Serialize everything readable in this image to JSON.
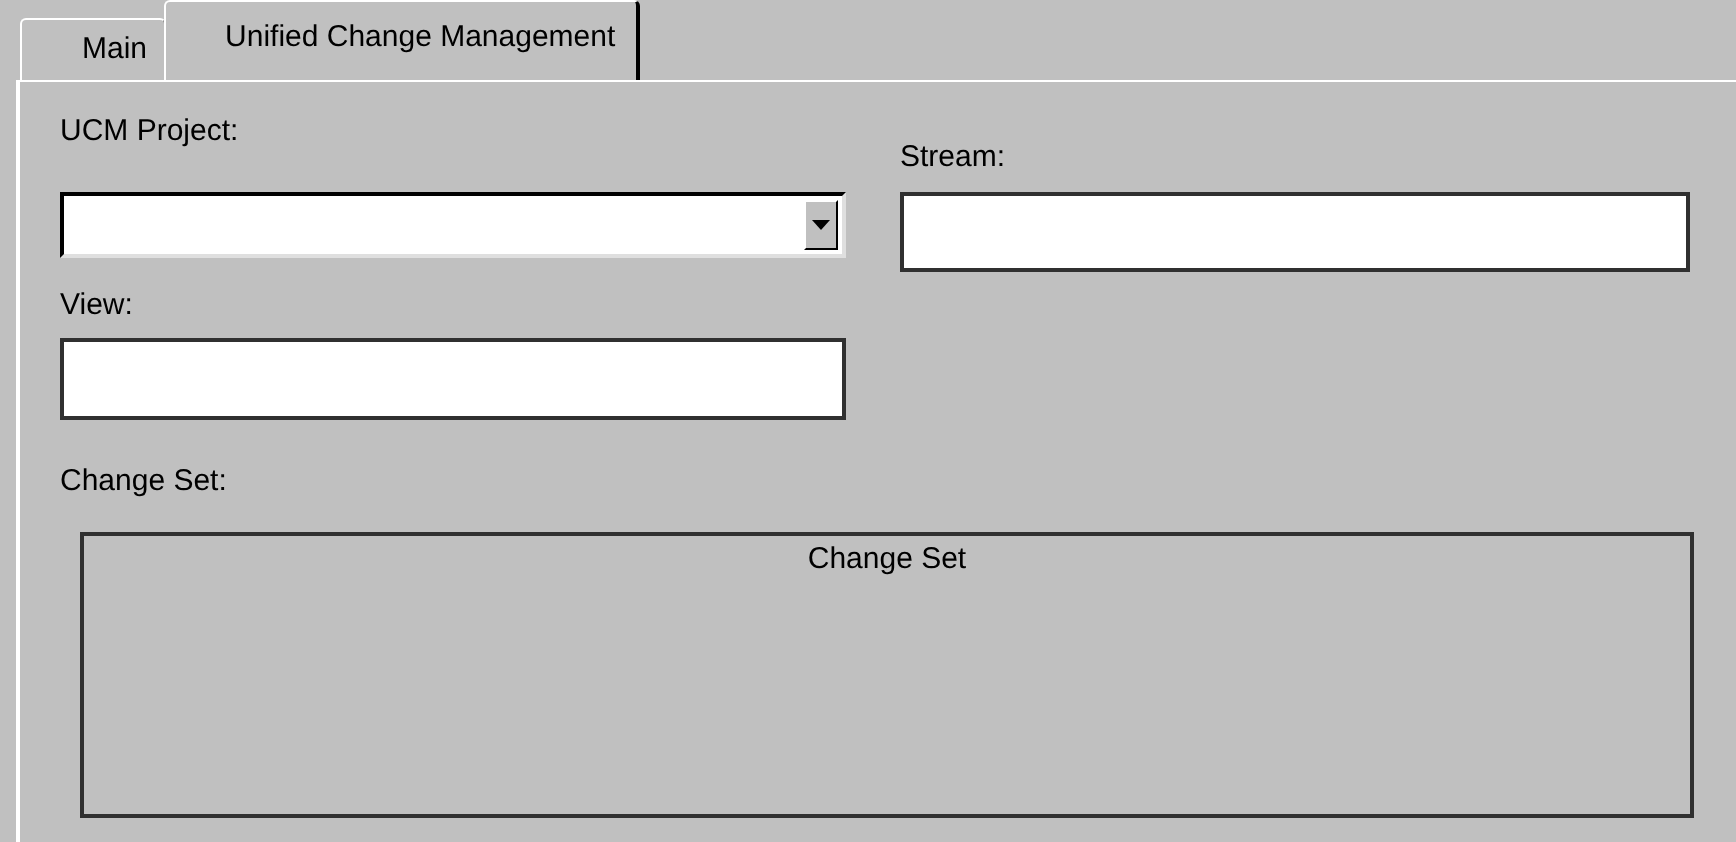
{
  "tabs": [
    {
      "label": "Main",
      "selected": false
    },
    {
      "label": "Unified Change Management",
      "selected": true
    }
  ],
  "fields": [
    {
      "label": "UCM Project:",
      "kind": "dropdown"
    },
    {
      "label": "Stream:",
      "kind": "text"
    },
    {
      "label": "View:",
      "kind": "text"
    }
  ],
  "change_set": {
    "label": "Change Set:",
    "header": "Change Set"
  }
}
